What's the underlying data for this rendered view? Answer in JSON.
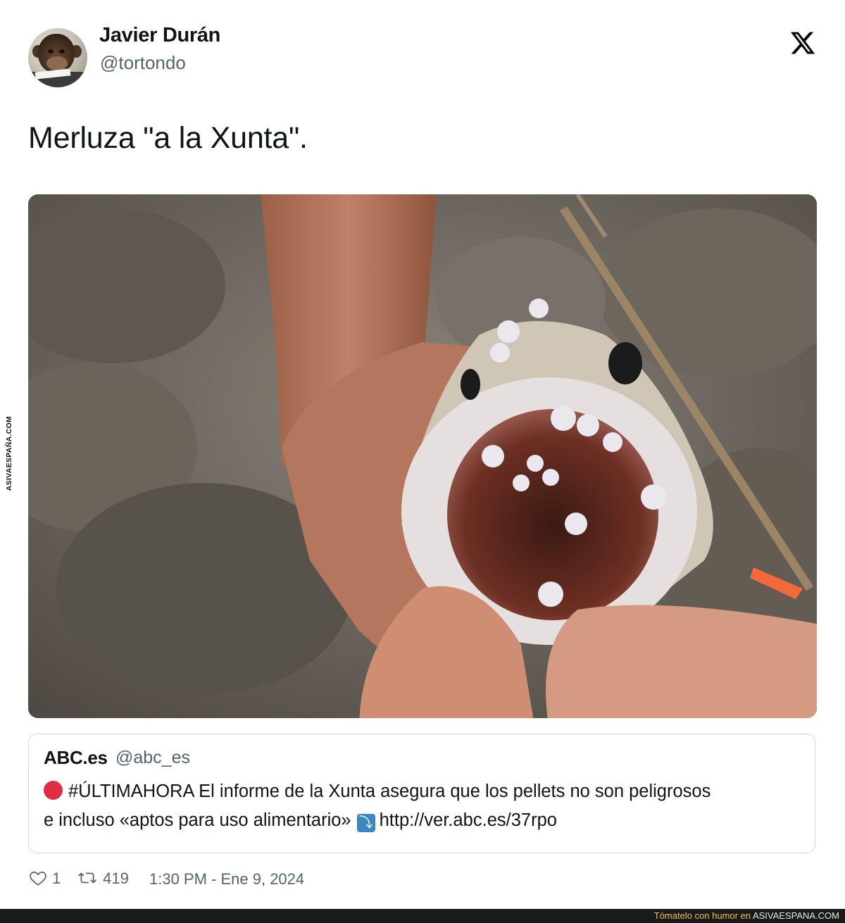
{
  "author": {
    "name": "Javier Durán",
    "handle": "@tortondo"
  },
  "logo_icon": "x-logo-icon",
  "tweet": {
    "text": "Merluza \"a la Xunta\"."
  },
  "watermark": {
    "text": "ASIVAESPAÑA.COM"
  },
  "quoted": {
    "name": "ABC.es",
    "handle": "@abc_es",
    "line1": "#ÚLTIMAHORA El informe de la Xunta asegura que los pellets no son peligrosos",
    "line2": "e incluso «aptos para uso alimentario»",
    "arrow_glyph": "⤵",
    "link": "http://ver.abc.es/37rpo"
  },
  "stats": {
    "likes": "1",
    "retweets": "419",
    "timestamp": "1:30 PM - Ene 9, 2024"
  },
  "footer": {
    "prefix": "Tómatelo con humor en",
    "site": "ASIVAESPANA.COM"
  },
  "colors": {
    "red_circle": "#dd2e44",
    "arrow_box": "#3b88c3",
    "secondary_text": "#536471"
  }
}
